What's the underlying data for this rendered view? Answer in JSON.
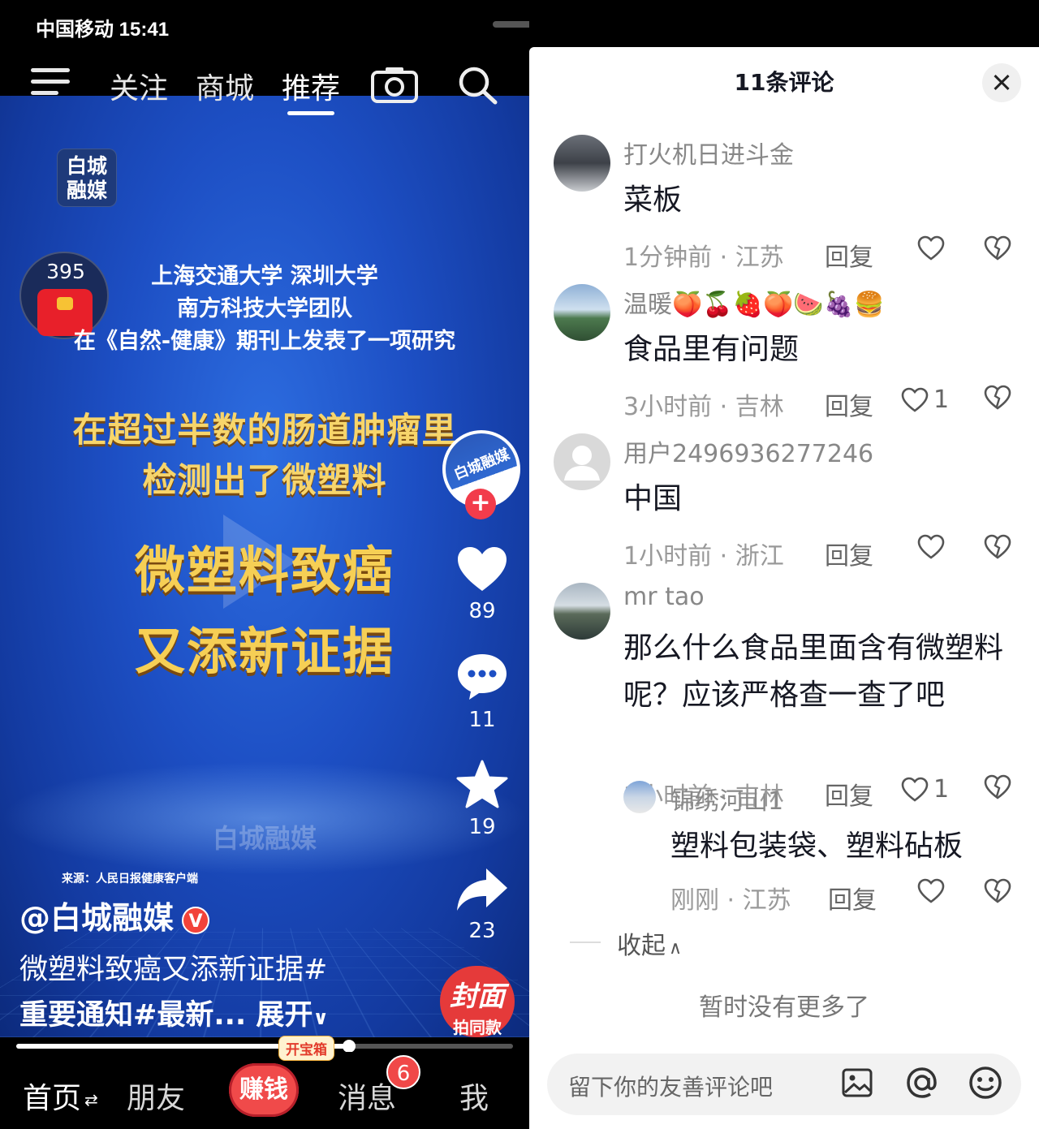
{
  "status_bar": {
    "carrier_time": "中国移动 15:41"
  },
  "top_nav": {
    "tabs": [
      {
        "label": "关注"
      },
      {
        "label": "商城"
      },
      {
        "label": "推荐"
      }
    ],
    "active_tab": "推荐"
  },
  "video": {
    "channel_logo": [
      "白城",
      "融媒"
    ],
    "reward_count": "395",
    "overlay_lines": [
      "上海交通大学 深圳大学",
      "南方科技大学团队",
      "在《自然-健康》期刊上发表了一项研究"
    ],
    "headline_lines": [
      "在超过半数的肠道肿瘤里",
      "检测出了微塑料"
    ],
    "big_title_lines": [
      "微塑料致癌",
      "又添新证据"
    ],
    "watermark": "白城融媒",
    "source": "来源：人民日报健康客户端",
    "author": "@白城融媒",
    "verified_badge": "V",
    "desc_line1": "微塑料致癌又添新证据#",
    "desc_line2": "重要通知#最新...",
    "expand_label": "展开",
    "progress": 0.67
  },
  "side_actions": {
    "likes": "89",
    "comments": "11",
    "favorites": "19",
    "shares": "23"
  },
  "same_style": {
    "logo_text": "封面",
    "label": "拍同款"
  },
  "bottom_nav": {
    "home": "首页",
    "friends": "朋友",
    "earn": "赚钱",
    "chest_tag": "开宝箱",
    "messages": "消息",
    "message_badge": "6",
    "me": "我"
  },
  "comments_panel": {
    "title": "11条评论",
    "comments": [
      {
        "name": "打火机日进斗金",
        "text": "菜板",
        "time_loc": "1分钟前 · 江苏",
        "reply": "回复",
        "likes": ""
      },
      {
        "name": "温暖🍑🍒🍓🍑🍉🍇🍔",
        "text": "食品里有问题",
        "time_loc": "3小时前 · 吉林",
        "reply": "回复",
        "likes": "1"
      },
      {
        "name": "用户2496936277246",
        "text": "中国",
        "time_loc": "1小时前 · 浙江",
        "reply": "回复",
        "likes": ""
      },
      {
        "name": "mr tao",
        "text": "那么什么食品里面含有微塑料呢？应该严格查一查了吧",
        "time_loc": "3小时前 · 吉林",
        "reply": "回复",
        "likes": "1"
      }
    ],
    "sub_reply": {
      "name": "锦绣河山1",
      "text": "塑料包装袋、塑料砧板",
      "time_loc": "刚刚 · 江苏",
      "reply": "回复",
      "likes": ""
    },
    "collapse_label": "收起",
    "no_more": "暂时没有更多了",
    "input_placeholder": "留下你的友善评论吧"
  },
  "colors": {
    "video_blue": "#1d4fc4",
    "gold_text": "#f6cf55",
    "red_accent": "#f04a4a"
  }
}
